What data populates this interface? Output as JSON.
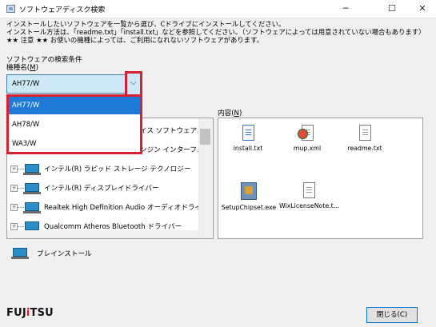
{
  "window": {
    "title": "ソフトウェアディスク検索",
    "minimize": "─",
    "maximize": "☐",
    "close": "✕"
  },
  "notice": {
    "line1": "インストールしたいソフトウェアを一覧から選び、Cドライブにインストールしてください。",
    "line2": "インストール方法は、「readme.txt」「install.txt」などを参照してください。（ソフトウェアによっては用意されていない場合もあります）",
    "line3": "★★ 注意 ★★ お使いの機種によっては、ご利用になれないソフトウェアがあります。"
  },
  "search": {
    "section_label": "ソフトウェアの検索条件",
    "model_label": "機種名(",
    "model_key": "M",
    "model_label_end": ")",
    "selected": "AH77/W",
    "options": [
      "AH77/W",
      "AH78/W",
      "WA3/W"
    ]
  },
  "tree": {
    "rows": [
      {
        "label": "イス ソフトウェア"
      },
      {
        "label": "ンジン インターフェイ"
      },
      {
        "label": "インテル(R) ラピッド ストレージ テクノロジー"
      },
      {
        "label": "インテル(R) ディスプレイドライバー"
      },
      {
        "label": "Realtek High Definition Audio オーディオドライバ"
      },
      {
        "label": "Qualcomm Atheros Bluetooth ドライバー"
      }
    ]
  },
  "content": {
    "label": "内容(",
    "key": "N",
    "label_end": ")",
    "files": [
      {
        "name": "install.txt",
        "icon": "text-file-icon"
      },
      {
        "name": "mup.xml",
        "icon": "xml-file-icon"
      },
      {
        "name": "readme.txt",
        "icon": "text-file-icon"
      },
      {
        "name": "SetupChipset.exe",
        "icon": "setup-exe-icon"
      },
      {
        "name": "WixLicenseNote.t...",
        "icon": "text-file-icon"
      }
    ]
  },
  "install": {
    "label": "ブレインストール"
  },
  "footer": {
    "brand_pre": "FUJ",
    "brand_i": "i",
    "brand_post": "TSU",
    "close_label": "閉じる(C)",
    "accent": "#d7202f"
  }
}
